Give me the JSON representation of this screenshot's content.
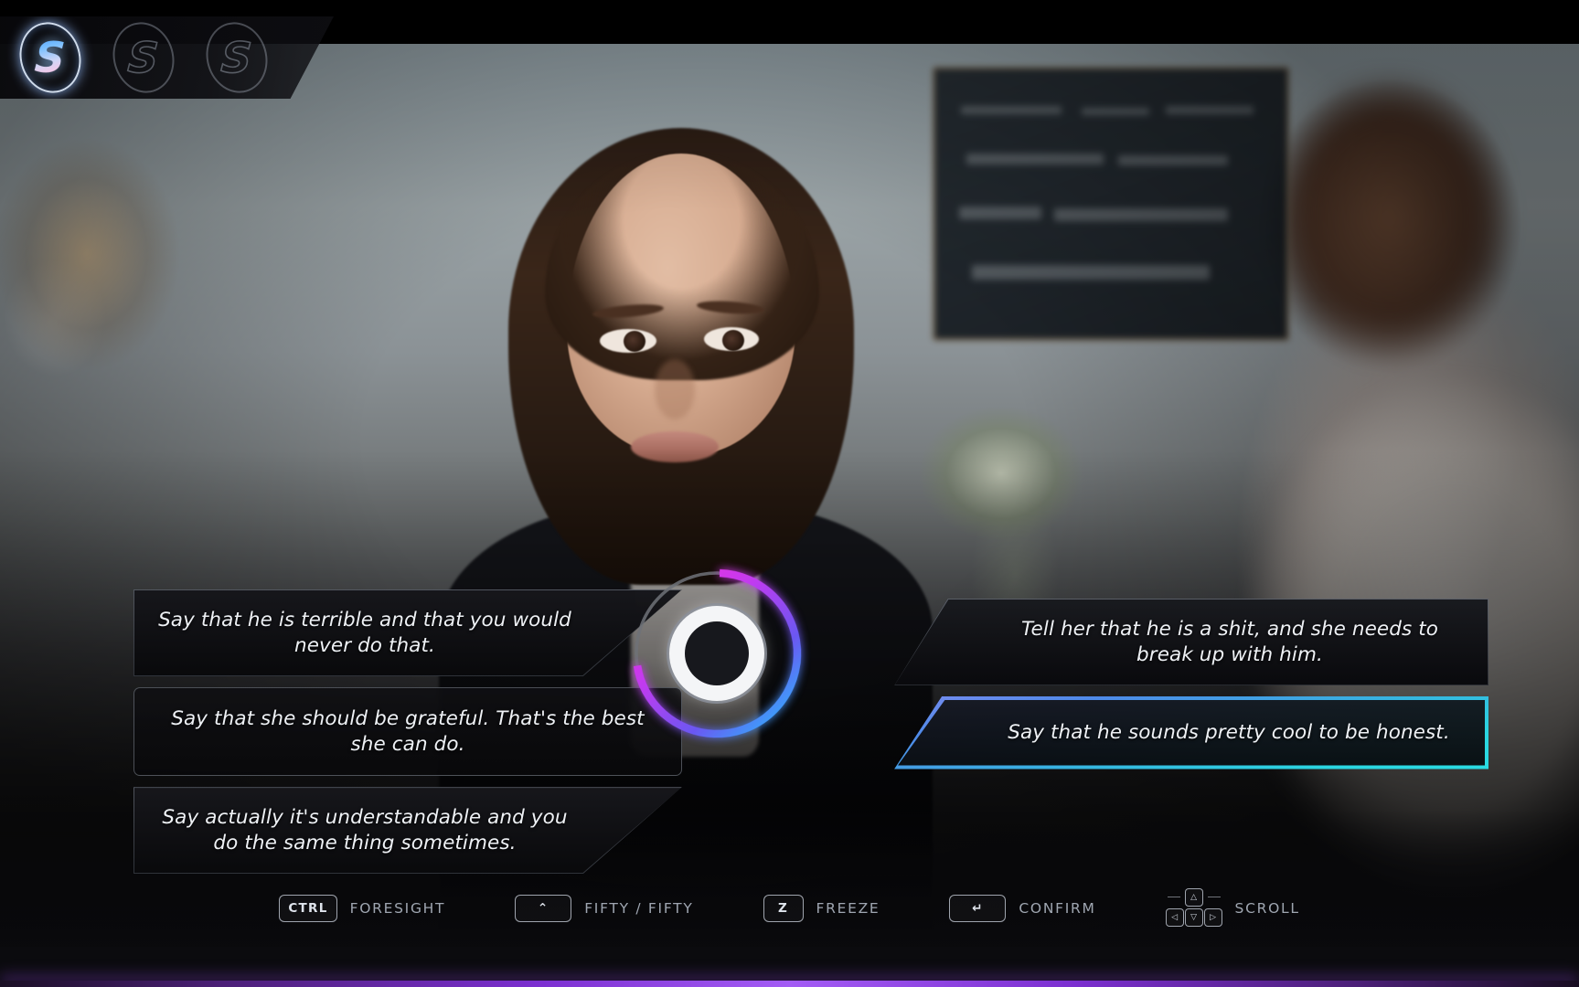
{
  "skill_bar": {
    "slots": [
      {
        "icon": "skill-s-icon",
        "label": "S",
        "state": "active"
      },
      {
        "icon": "skill-s-icon",
        "label": "S",
        "state": "empty"
      },
      {
        "icon": "skill-s-icon",
        "label": "S",
        "state": "empty"
      }
    ]
  },
  "dialogue": {
    "left_options": [
      {
        "text": "Say that he is terrible and that you would never do that.",
        "shape": "slant",
        "selected": false
      },
      {
        "text": "Say that she should be grateful. That's the best she can do.",
        "shape": "rect",
        "selected": false
      },
      {
        "text": "Say actually it's understandable and you do the same thing sometimes.",
        "shape": "slant",
        "selected": false
      }
    ],
    "right_options": [
      {
        "text": "Tell her that he is a shit, and she needs to break up with him.",
        "shape": "slant",
        "selected": false
      },
      {
        "text": "Say that he sounds pretty cool to be honest.",
        "shape": "slant",
        "selected": true
      }
    ]
  },
  "timer": {
    "progress_percent": 72,
    "gradient": {
      "start": "#ff2fd6",
      "mid": "#9b3bf5",
      "end": "#23b6ff"
    },
    "track_color": "#6f7278"
  },
  "controls": [
    {
      "key": "CTRL",
      "label": "FORESIGHT",
      "key_style": "text"
    },
    {
      "key": "⌃",
      "label": "FIFTY / FIFTY",
      "key_style": "glyph-wide"
    },
    {
      "key": "Z",
      "label": "FREEZE",
      "key_style": "text"
    },
    {
      "key": "↵",
      "label": "CONFIRM",
      "key_style": "glyph-wide"
    },
    {
      "key": "dpad",
      "label": "SCROLL",
      "key_style": "dpad"
    }
  ],
  "dpad_keys": {
    "up": "△",
    "left": "◁",
    "down": "▽",
    "right": "▷"
  },
  "theme": {
    "accent_cyan": "#2ad6e2",
    "accent_blue": "#4f8ae8",
    "accent_magenta": "#ff2fd6",
    "accent_purple": "#9b3bf5",
    "bottom_bar_glow": "#a35cf5",
    "panel_bg": "#0b0b0e",
    "text_primary": "#eef1f5",
    "text_muted": "#9fa6b1"
  }
}
